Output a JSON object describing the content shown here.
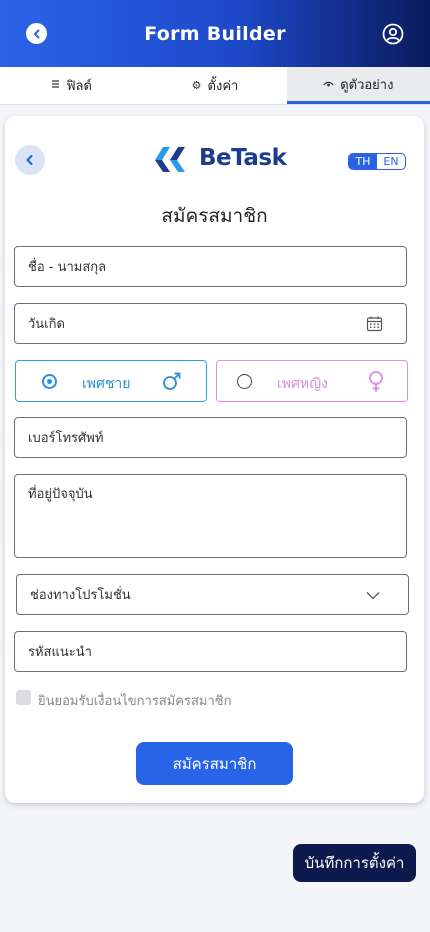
{
  "header": {
    "title": "Form Builder",
    "back_icon": "chevron-left-icon",
    "user_icon": "user-circle-icon"
  },
  "tabs": [
    {
      "label": "ฟิลด์",
      "icon": "list-icon",
      "active": false
    },
    {
      "label": "ตั้งค่า",
      "icon": "gear-icon",
      "active": false
    },
    {
      "label": "ดูตัวอย่าง",
      "icon": "eye-icon",
      "active": true
    }
  ],
  "form": {
    "logo_text": "BeTask",
    "lang": {
      "th": "TH",
      "en": "EN",
      "selected": "TH"
    },
    "title": "สมัครสมาชิก",
    "fields": {
      "fullname": "ชื่อ - นามสกุล",
      "birthdate": "วันเกิด",
      "phone": "เบอร์โทรศัพท์",
      "address": "ที่อยู่ปัจจุบัน",
      "promo_channel": "ช่องทางโปรโมชั่น",
      "referral": "รหัสแนะนำ"
    },
    "gender": {
      "male": "เพศชาย",
      "female": "เพศหญิง",
      "selected": "male"
    },
    "terms_label": "ยินยอมรับเงื่อนไขการสมัครสมาชิก",
    "submit_label": "สมัครสมาชิก"
  },
  "save_button": "บันทึกการตั้งค่า",
  "colors": {
    "primary": "#2764e8",
    "header_dark": "#0a1a5c",
    "male": "#2b8fd6",
    "female": "#d98ce0",
    "save_button_bg": "#0c1a4d"
  }
}
